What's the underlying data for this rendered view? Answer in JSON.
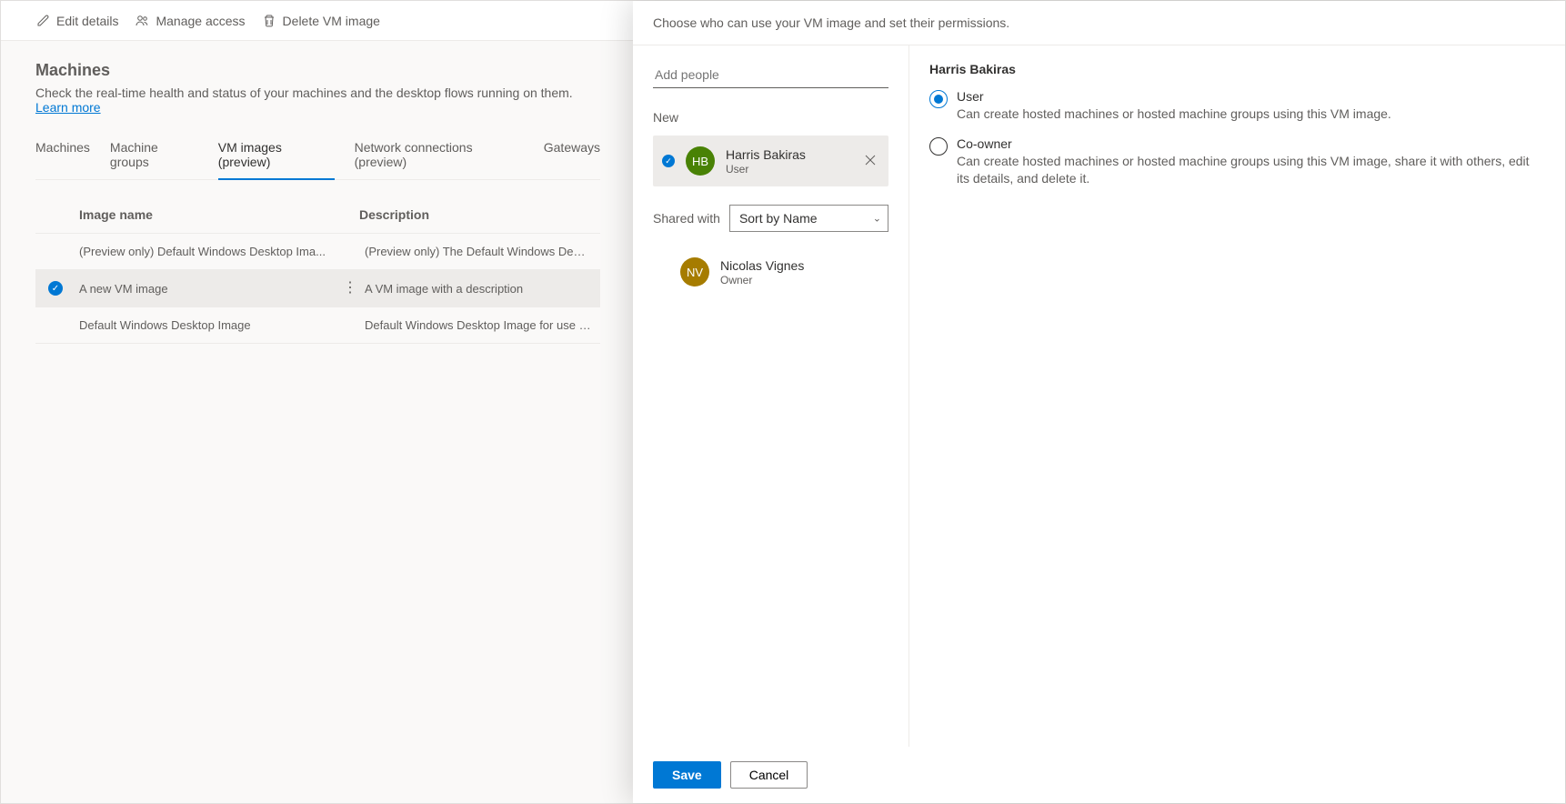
{
  "toolbar": {
    "edit": "Edit details",
    "manage": "Manage access",
    "delete": "Delete VM image"
  },
  "page": {
    "title": "Machines",
    "subtitle": "Check the real-time health and status of your machines and the desktop flows running on them. ",
    "learn_more": "Learn more"
  },
  "tabs": {
    "machines": "Machines",
    "groups": "Machine groups",
    "vm_images": "VM images (preview)",
    "network": "Network connections (preview)",
    "gateways": "Gateways"
  },
  "table": {
    "col_name": "Image name",
    "col_desc": "Description",
    "rows": [
      {
        "name": "(Preview only) Default Windows Desktop Ima...",
        "desc": "(Preview only) The Default Windows Desktop Image for use i..."
      },
      {
        "name": "A new VM image",
        "desc": "A VM image with a description"
      },
      {
        "name": "Default Windows Desktop Image",
        "desc": "Default Windows Desktop Image for use in Microsoft Deskto..."
      }
    ]
  },
  "panel": {
    "header": "Choose who can use your VM image and set their permissions.",
    "add_placeholder": "Add people",
    "new_label": "New",
    "new_person": {
      "initials": "HB",
      "name": "Harris Bakiras",
      "role": "User"
    },
    "shared_with_label": "Shared with",
    "sort_label": "Sort by Name",
    "shared_person": {
      "initials": "NV",
      "name": "Nicolas Vignes",
      "role": "Owner"
    },
    "detail_name": "Harris Bakiras",
    "options": {
      "user": {
        "label": "User",
        "desc": "Can create hosted machines or hosted machine groups using this VM image."
      },
      "coowner": {
        "label": "Co-owner",
        "desc": "Can create hosted machines or hosted machine groups using this VM image, share it with others, edit its details, and delete it."
      }
    },
    "save": "Save",
    "cancel": "Cancel"
  }
}
